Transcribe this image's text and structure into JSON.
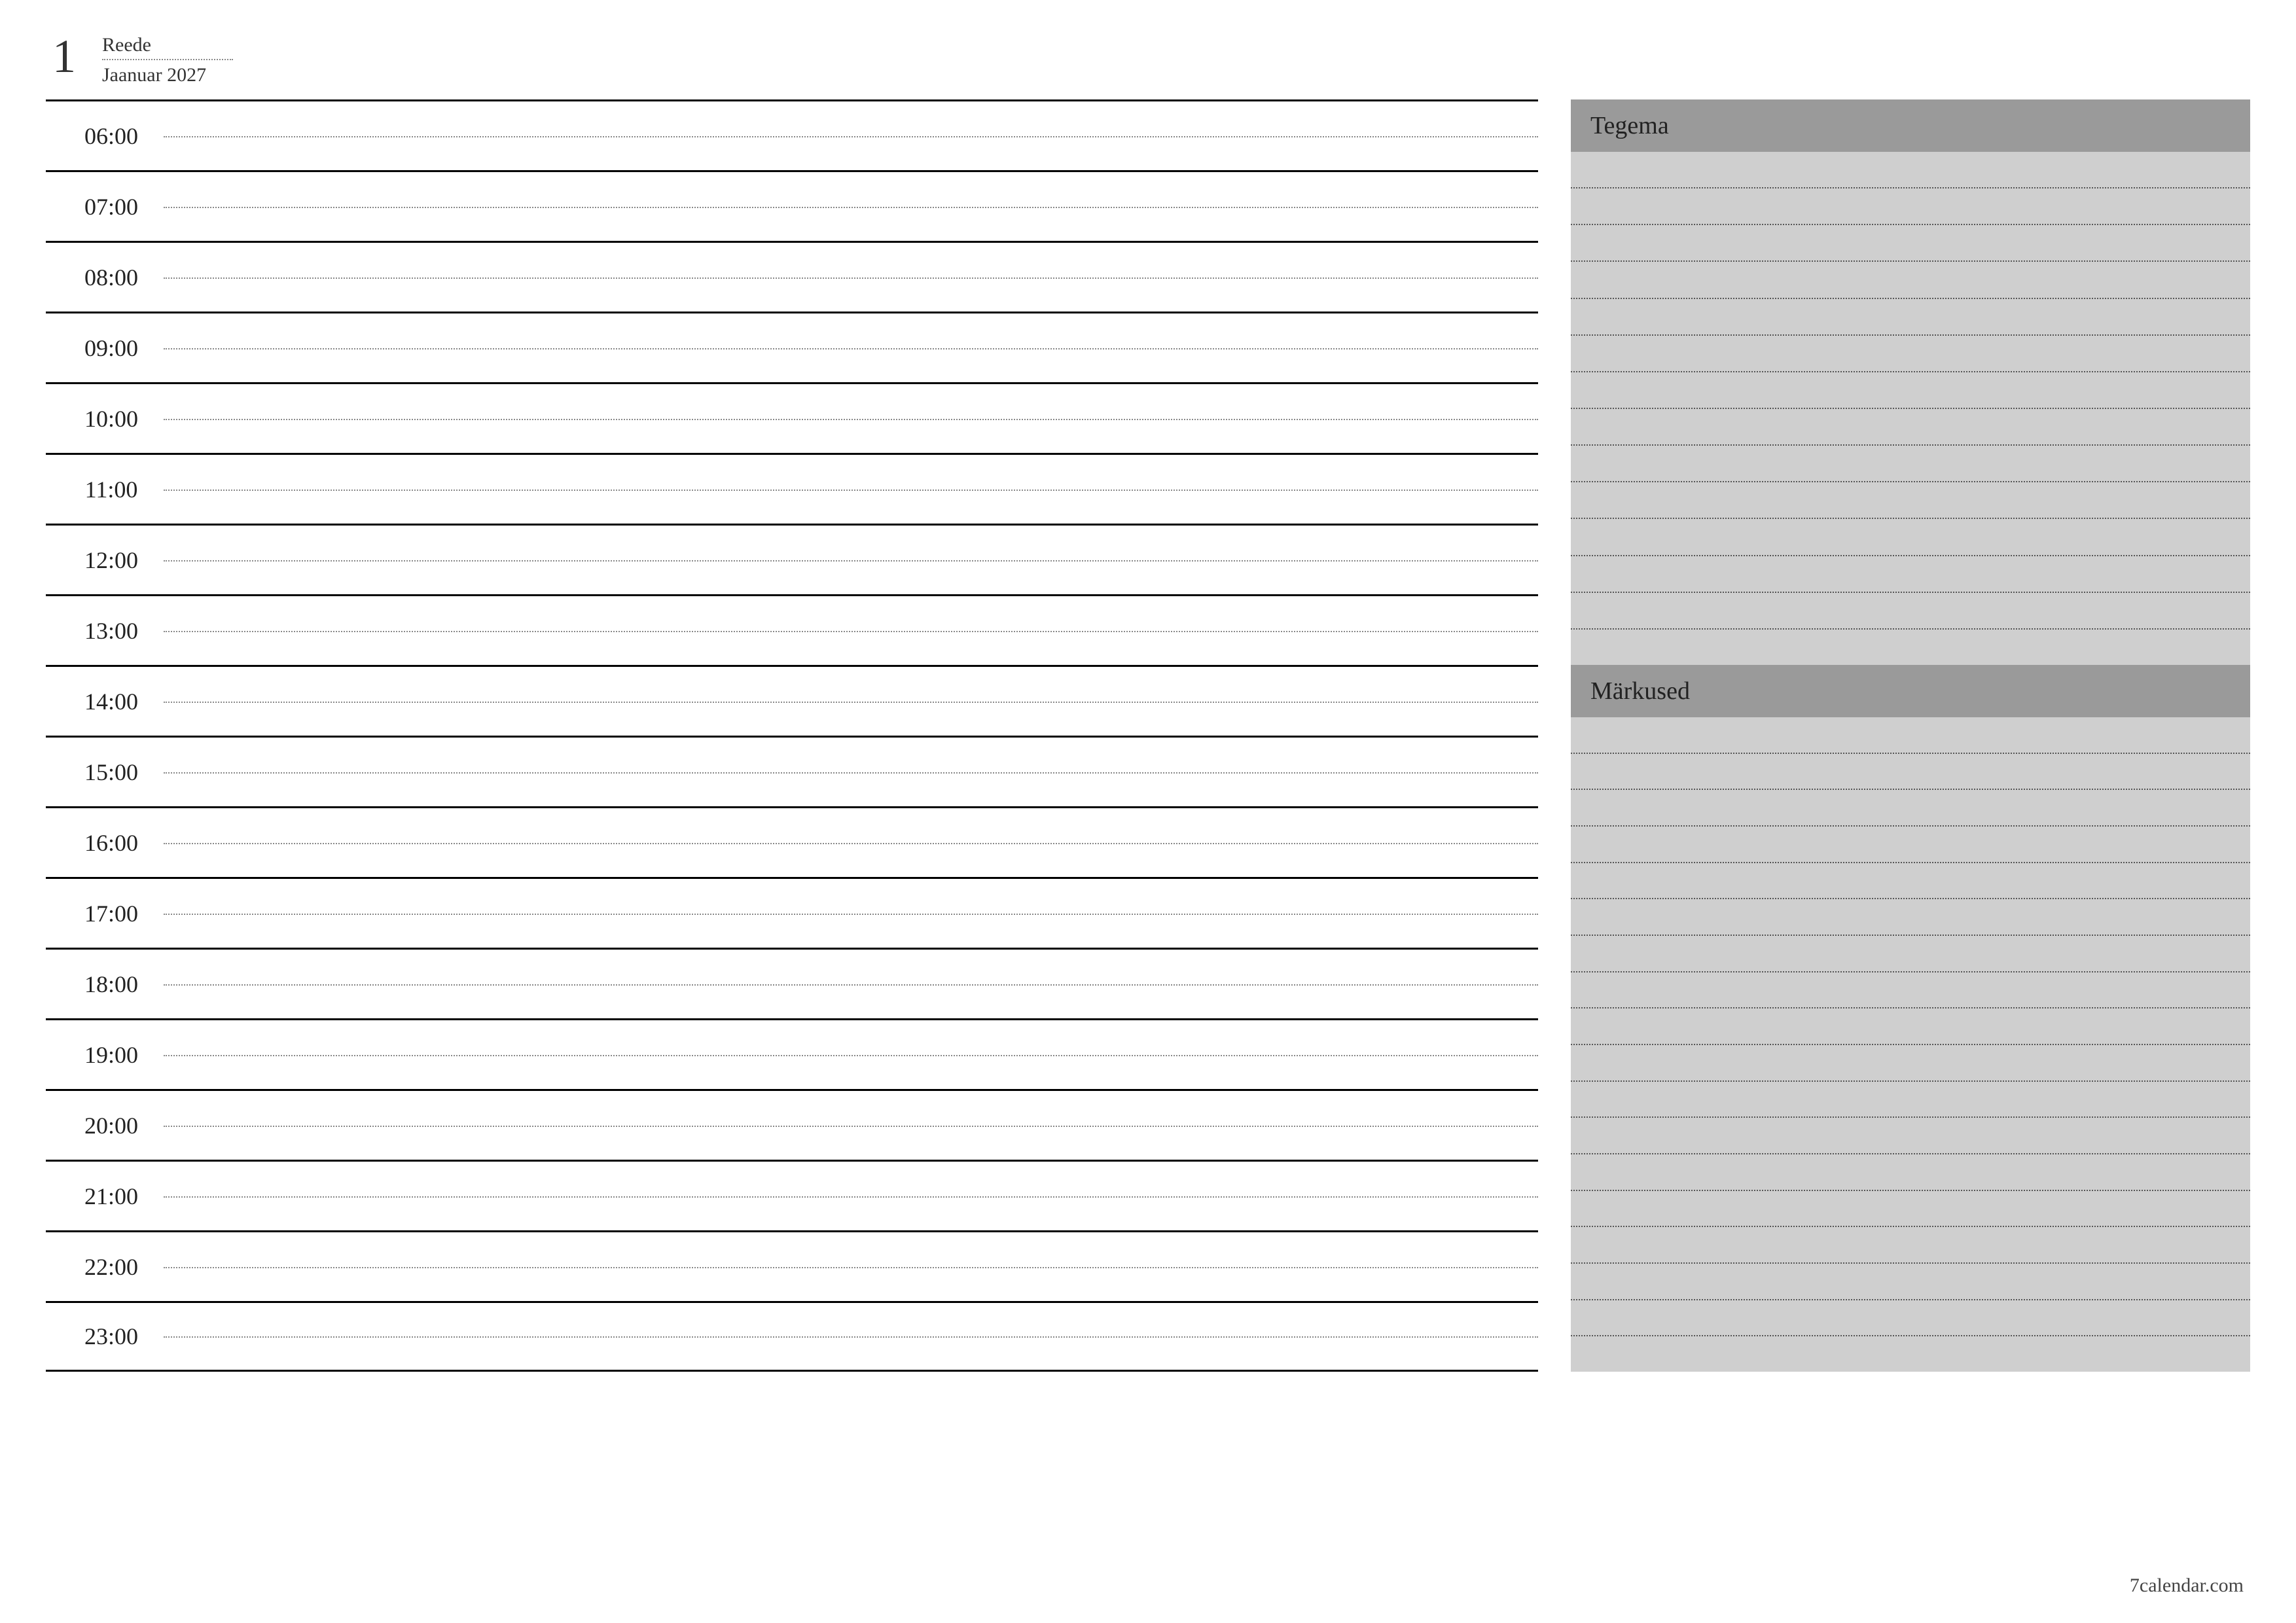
{
  "header": {
    "day_number": "1",
    "weekday": "Reede",
    "month_year": "Jaanuar 2027"
  },
  "schedule": {
    "hours": [
      "06:00",
      "07:00",
      "08:00",
      "09:00",
      "10:00",
      "11:00",
      "12:00",
      "13:00",
      "14:00",
      "15:00",
      "16:00",
      "17:00",
      "18:00",
      "19:00",
      "20:00",
      "21:00",
      "22:00",
      "23:00"
    ]
  },
  "sidebar": {
    "todo_title": "Tegema",
    "notes_title": "Märkused",
    "todo_line_count": 14,
    "notes_line_count": 18
  },
  "footer": {
    "site": "7calendar.com"
  }
}
